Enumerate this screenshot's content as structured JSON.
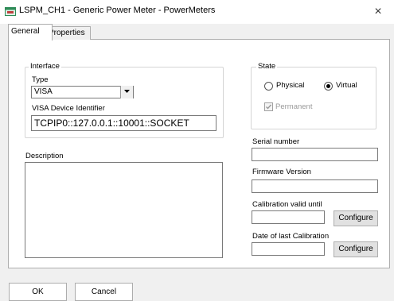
{
  "window": {
    "title": "LSPM_CH1 - Generic Power Meter - PowerMeters",
    "close_glyph": "×"
  },
  "tabs": [
    {
      "label": "General",
      "selected": true
    },
    {
      "label": "Properties",
      "selected": false
    }
  ],
  "interface": {
    "group_label": "Interface",
    "type_label": "Type",
    "type_value": "VISA",
    "visa_label": "VISA Device Identifier",
    "visa_value": "TCPIP0::127.0.0.1::10001::SOCKET"
  },
  "state": {
    "group_label": "State",
    "physical_label": "Physical",
    "virtual_label": "Virtual",
    "selected": "Virtual",
    "permanent_label": "Permanent",
    "permanent_checked": true,
    "permanent_enabled": false
  },
  "description": {
    "label": "Description",
    "value": ""
  },
  "serial_number": {
    "label": "Serial number",
    "value": ""
  },
  "firmware_version": {
    "label": "Firmware Version",
    "value": ""
  },
  "calibration_valid_until": {
    "label": "Calibration valid until",
    "value": "",
    "button": "Configure"
  },
  "date_last_calibration": {
    "label": "Date of last Calibration",
    "value": "",
    "button": "Configure"
  },
  "footer": {
    "ok_label": "OK",
    "cancel_label": "Cancel"
  },
  "icons": {
    "app": "app-window-icon",
    "close": "close-icon",
    "dropdown": "chevron-down-icon",
    "check": "checkmark-icon"
  }
}
